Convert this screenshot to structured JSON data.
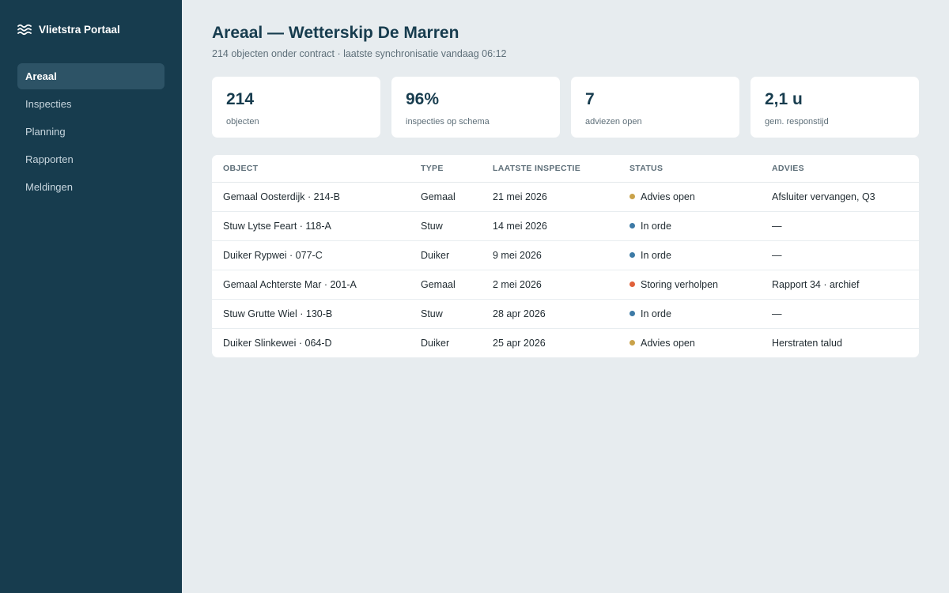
{
  "app": {
    "name": "Vlietstra Portaal",
    "icon": "waves-icon"
  },
  "sidebar": {
    "items": [
      {
        "label": "Areaal",
        "active": true
      },
      {
        "label": "Inspecties",
        "active": false
      },
      {
        "label": "Planning",
        "active": false
      },
      {
        "label": "Rapporten",
        "active": false
      },
      {
        "label": "Meldingen",
        "active": false
      }
    ]
  },
  "header": {
    "title": "Areaal — Wetterskip De Marren",
    "subtitle": "214 objecten onder contract · laatste synchronisatie vandaag 06:12"
  },
  "stats": [
    {
      "value": "214",
      "label": "objecten"
    },
    {
      "value": "96%",
      "label": "inspecties op schema"
    },
    {
      "value": "7",
      "label": "adviezen open"
    },
    {
      "value": "2,1 u",
      "label": "gem. responstijd"
    }
  ],
  "table": {
    "columns": [
      "OBJECT",
      "TYPE",
      "LAATSTE INSPECTIE",
      "STATUS",
      "ADVIES"
    ],
    "rows": [
      {
        "object": "Gemaal Oosterdijk · 214-B",
        "type": "Gemaal",
        "date": "21 mei 2026",
        "status": "Advies open",
        "status_color": "#c9a24a",
        "advice": "Afsluiter vervangen, Q3"
      },
      {
        "object": "Stuw Lytse Feart · 118-A",
        "type": "Stuw",
        "date": "14 mei 2026",
        "status": "In orde",
        "status_color": "#3d7aa6",
        "advice": "—"
      },
      {
        "object": "Duiker Rypwei · 077-C",
        "type": "Duiker",
        "date": "9 mei 2026",
        "status": "In orde",
        "status_color": "#3d7aa6",
        "advice": "—"
      },
      {
        "object": "Gemaal Achterste Mar · 201-A",
        "type": "Gemaal",
        "date": "2 mei 2026",
        "status": "Storing verholpen",
        "status_color": "#e0603a",
        "advice": "Rapport 34 · archief"
      },
      {
        "object": "Stuw Grutte Wiel · 130-B",
        "type": "Stuw",
        "date": "28 apr 2026",
        "status": "In orde",
        "status_color": "#3d7aa6",
        "advice": "—"
      },
      {
        "object": "Duiker Slinkewei · 064-D",
        "type": "Duiker",
        "date": "25 apr 2026",
        "status": "Advies open",
        "status_color": "#c9a24a",
        "advice": "Herstraten talud"
      }
    ]
  }
}
